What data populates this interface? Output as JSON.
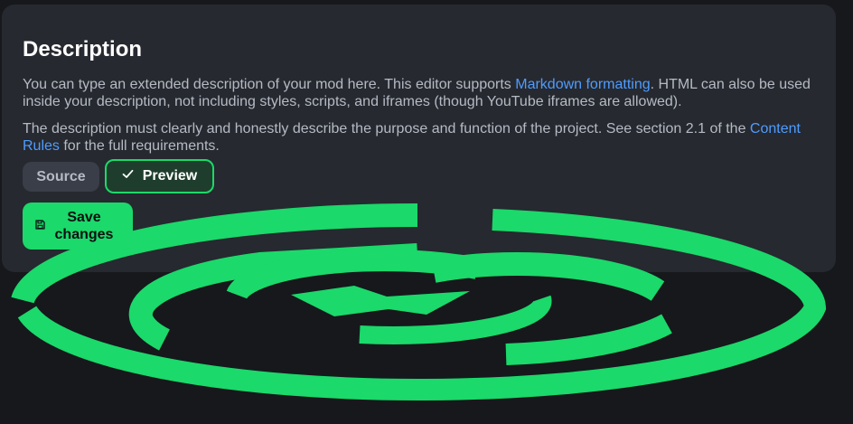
{
  "card": {
    "title": "Description",
    "para1": {
      "before": "You can type an extended description of your mod here. This editor supports ",
      "link": "Markdown formatting",
      "after": ". HTML can also be used inside your description, not including styles, scripts, and iframes (though YouTube iframes are allowed)."
    },
    "para2": {
      "before": "The description must clearly and honestly describe the purpose and function of the project. See section 2.1 of the ",
      "link": "Content Rules",
      "after": " for the full requirements."
    }
  },
  "tabs": {
    "source_label": "Source",
    "preview_label": "Preview",
    "active": "Preview"
  },
  "actions": {
    "save_label": "Save changes"
  },
  "colors": {
    "brand_green": "#1bd96a",
    "card_bg": "#26292f",
    "page_bg": "#16181c",
    "link": "#4f9cff"
  },
  "icons": {
    "preview": "check-icon",
    "save": "save-icon",
    "overlay": "modrinth-logo"
  }
}
